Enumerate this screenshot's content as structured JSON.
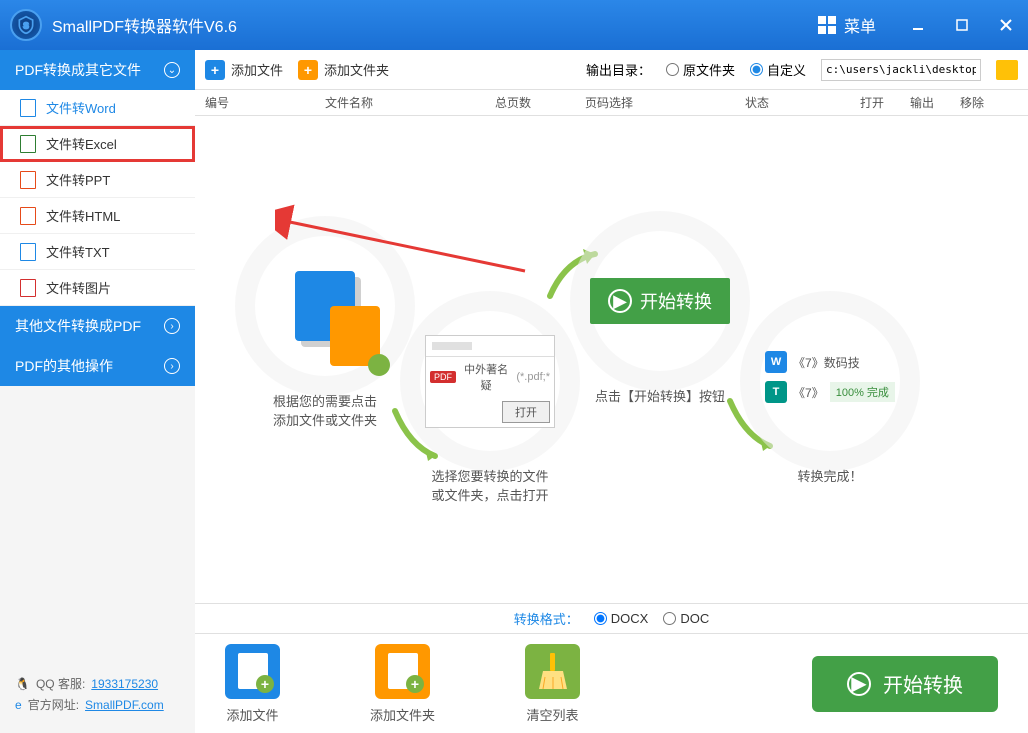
{
  "title": "SmallPDF转换器软件V6.6",
  "menu_label": "菜单",
  "sidebar": {
    "section1": "PDF转换成其它文件",
    "items": [
      "文件转Word",
      "文件转Excel",
      "文件转PPT",
      "文件转HTML",
      "文件转TXT",
      "文件转图片"
    ],
    "section2": "其他文件转换成PDF",
    "section3": "PDF的其他操作",
    "qq_label": "QQ 客服:",
    "qq_value": "1933175230",
    "site_label": "官方网址:",
    "site_value": "SmallPDF.com"
  },
  "toolbar": {
    "add_file": "添加文件",
    "add_folder": "添加文件夹",
    "output_label": "输出目录：",
    "opt_original": "原文件夹",
    "opt_custom": "自定义",
    "path": "c:\\users\\jackli\\desktop\\"
  },
  "columns": {
    "no": "编号",
    "name": "文件名称",
    "pages": "总页数",
    "range": "页码选择",
    "status": "状态",
    "open": "打开",
    "out": "输出",
    "rem": "移除"
  },
  "steps": {
    "s1": "根据您的需要点击\n添加文件或文件夹",
    "s2": "选择您要转换的文件\n或文件夹，点击打开",
    "s2_pdf_name": "中外著名疑",
    "s2_ext": "(*.pdf;*",
    "s2_open": "打开",
    "s3": "点击【开始转换】按钮",
    "s3_btn": "开始转换",
    "s4": "转换完成！",
    "s4_f1": "《7》数码技",
    "s4_f2": "《7》",
    "s4_prog": "100% 完成"
  },
  "format": {
    "label": "转换格式：",
    "docx": "DOCX",
    "doc": "DOC"
  },
  "bottom": {
    "add_file": "添加文件",
    "add_folder": "添加文件夹",
    "clear": "清空列表",
    "start": "开始转换"
  }
}
